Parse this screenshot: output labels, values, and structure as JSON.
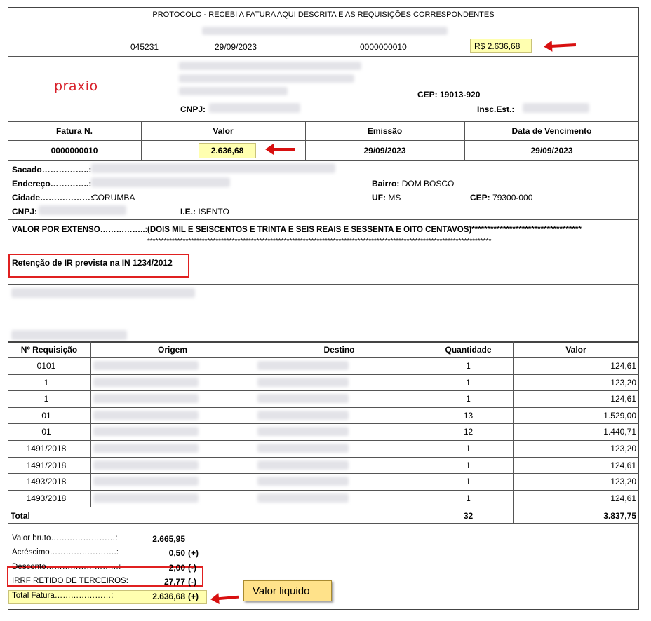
{
  "protocol": {
    "title": "PROTOCOLO - RECEBI A FATURA AQUI DESCRITA E AS REQUISIÇÕES CORRESPONDENTES",
    "code": "045231",
    "date": "29/09/2023",
    "invoice_no": "0000000010",
    "amount": "R$ 2.636,68"
  },
  "company": {
    "logo_text": "praxio",
    "cep_label": "CEP:",
    "cep": "19013-920",
    "cnpj_label": "CNPJ:",
    "insc_label": "Insc.Est.:"
  },
  "invoice_header": {
    "col_fatura": "Fatura N.",
    "col_valor": "Valor",
    "col_emissao": "Emissão",
    "col_vencimento": "Data de Vencimento",
    "fatura": "0000000010",
    "valor": "2.636,68",
    "emissao": "29/09/2023",
    "vencimento": "29/09/2023"
  },
  "sacado": {
    "sacado_label": "Sacado……………..:",
    "endereco_label": "Endereço…………..:",
    "cidade_label": "Cidade………………:",
    "cidade": "CORUMBA",
    "cnpj_label": "CNPJ:",
    "ie_label": "I.E.:",
    "ie": "ISENTO",
    "bairro_label": "Bairro:",
    "bairro": "DOM BOSCO",
    "uf_label": "UF:",
    "uf": "MS",
    "cep_label": "CEP:",
    "cep": "79300-000"
  },
  "extenso": {
    "label": "VALOR POR EXTENSO……………..:",
    "line1": "(DOIS MIL E SEISCENTOS E TRINTA E SEIS REAIS E SESSENTA E OITO CENTAVOS)***********************************",
    "line2": "******************************************************************************************************************************"
  },
  "retencao": "Retenção de IR prevista na IN 1234/2012",
  "table": {
    "headers": [
      "Nº Requisição",
      "Origem",
      "Destino",
      "Quantidade",
      "Valor"
    ],
    "rows": [
      {
        "req": "0101",
        "qtd": "1",
        "valor": "124,61"
      },
      {
        "req": "1",
        "qtd": "1",
        "valor": "123,20"
      },
      {
        "req": "1",
        "qtd": "1",
        "valor": "124,61"
      },
      {
        "req": "01",
        "qtd": "13",
        "valor": "1.529,00"
      },
      {
        "req": "01",
        "qtd": "12",
        "valor": "1.440,71"
      },
      {
        "req": "1491/2018",
        "qtd": "1",
        "valor": "123,20"
      },
      {
        "req": "1491/2018",
        "qtd": "1",
        "valor": "124,61"
      },
      {
        "req": "1493/2018",
        "qtd": "1",
        "valor": "123,20"
      },
      {
        "req": "1493/2018",
        "qtd": "1",
        "valor": "124,61"
      }
    ],
    "total_label": "Total",
    "total_qtd": "32",
    "total_valor": "3.837,75"
  },
  "summary": [
    {
      "label": "Valor bruto……………………:",
      "value": "2.665,95",
      "sign": ""
    },
    {
      "label": "Acréscimo…………………….:",
      "value": "0,50",
      "sign": "(+)"
    },
    {
      "label": "Desconto………………………:",
      "value": "2,00",
      "sign": "(-)"
    },
    {
      "label": "IRRF RETIDO DE TERCEIROS:",
      "value": "27,77",
      "sign": "(-)"
    },
    {
      "label": "Total Fatura…………………:",
      "value": "2.636,68",
      "sign": "(+)"
    }
  ],
  "callout": "Valor liquido",
  "colors": {
    "highlight": "#ffffb0",
    "annotation_red": "#e02020",
    "logo_red": "#d8202a",
    "callout_bg": "#ffe28a"
  }
}
